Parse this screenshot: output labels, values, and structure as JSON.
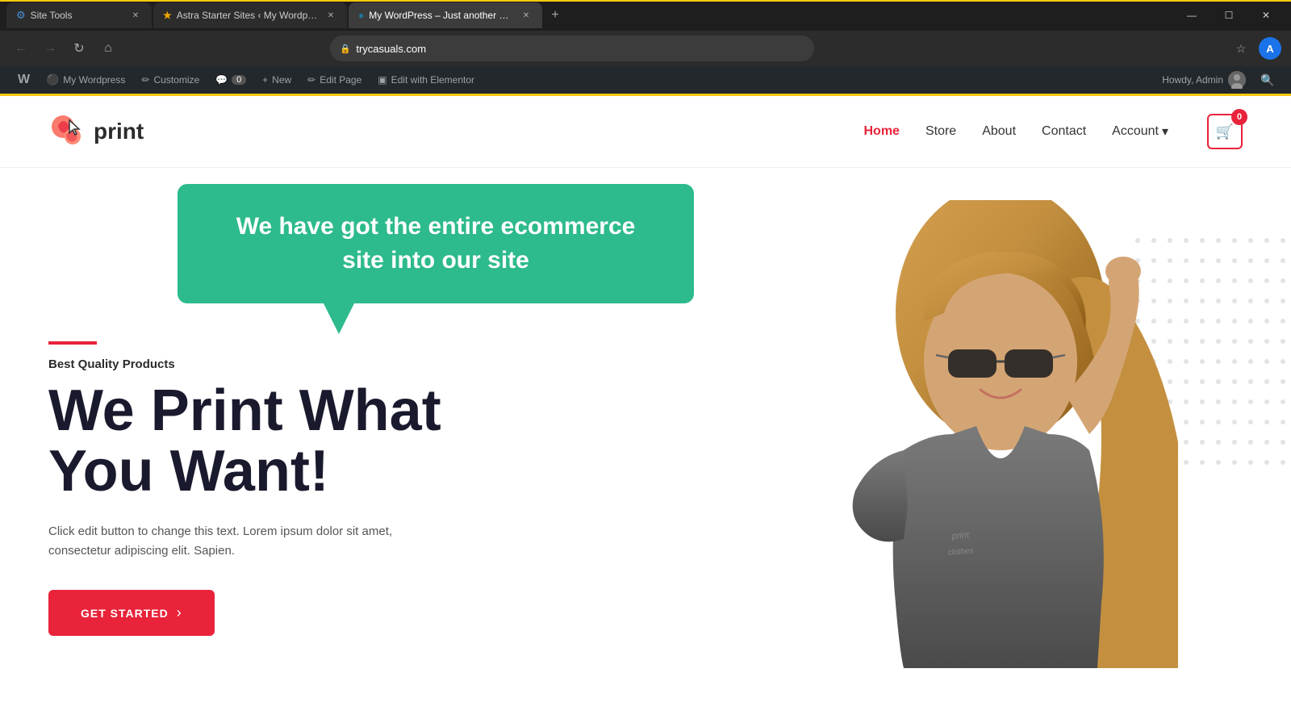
{
  "browser": {
    "tabs": [
      {
        "id": "tab1",
        "title": "Site Tools",
        "favicon": "⚙",
        "favicon_color": "#4a90d9",
        "active": false
      },
      {
        "id": "tab2",
        "title": "Astra Starter Sites ‹ My Wordpre...",
        "favicon": "★",
        "favicon_color": "#f0a500",
        "active": false
      },
      {
        "id": "tab3",
        "title": "My WordPress – Just another W...",
        "favicon": "●",
        "favicon_color": "#21759b",
        "active": true
      }
    ],
    "new_tab_label": "+",
    "window_controls": {
      "minimize": "—",
      "maximize": "☐",
      "close": "✕"
    },
    "nav": {
      "back_disabled": false,
      "forward_disabled": false,
      "refresh": "↻",
      "home": "⌂"
    },
    "url": "trycasuals.com",
    "address_icons": {
      "bookmark": "☆",
      "profile": "A"
    }
  },
  "wp_admin_bar": {
    "items": [
      {
        "id": "wp-logo",
        "label": "",
        "icon": "W"
      },
      {
        "id": "my-wordpress",
        "label": "My Wordpress",
        "icon": ""
      },
      {
        "id": "customize",
        "label": "Customize",
        "icon": "✏"
      },
      {
        "id": "comments",
        "label": "0",
        "icon": "💬"
      },
      {
        "id": "new",
        "label": "New",
        "icon": "+"
      },
      {
        "id": "edit-page",
        "label": "Edit Page",
        "icon": "✏"
      },
      {
        "id": "edit-elementor",
        "label": "Edit with Elementor",
        "icon": "▣"
      }
    ],
    "howdy": "Howdy, Admin",
    "search_icon": "🔍"
  },
  "site": {
    "logo_text": "print",
    "nav": {
      "items": [
        {
          "id": "home",
          "label": "Home",
          "active": true
        },
        {
          "id": "store",
          "label": "Store",
          "active": false
        },
        {
          "id": "about",
          "label": "About",
          "active": false
        },
        {
          "id": "contact",
          "label": "Contact",
          "active": false
        },
        {
          "id": "account",
          "label": "Account",
          "active": false,
          "has_dropdown": true
        }
      ],
      "cart_count": "0"
    },
    "hero": {
      "bubble_text": "We have got the entire ecommerce site into our site",
      "divider_color": "#e8233a",
      "subtitle": "Best Quality Products",
      "title_line1": "We Print What",
      "title_line2": "You Want!",
      "description": "Click edit button to change this text. Lorem ipsum dolor sit amet, consectetur adipiscing elit. Sapien.",
      "cta_label": "GET STARTED",
      "cta_arrow": "›"
    }
  },
  "dots": {
    "color": "#d0d0d0",
    "rows": 12,
    "cols": 10
  }
}
